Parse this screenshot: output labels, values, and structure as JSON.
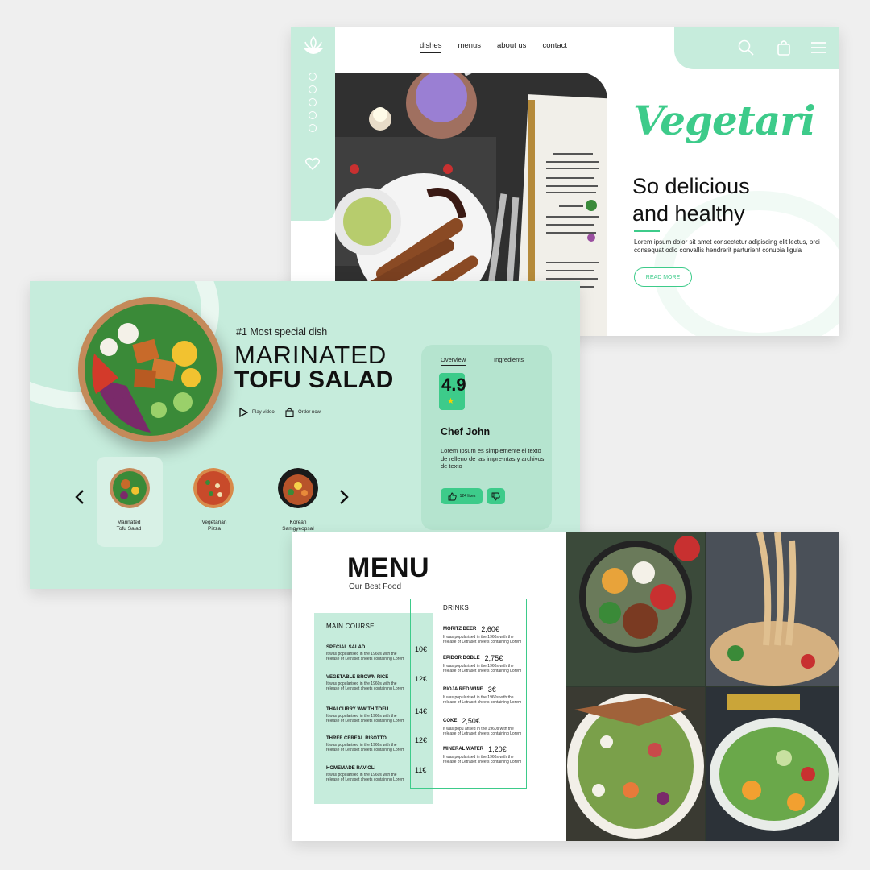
{
  "colors": {
    "accent": "#3dcb8a",
    "mint": "#c6ecdc",
    "mint_dark": "#b5e4cf"
  },
  "hero": {
    "nav": [
      "dishes",
      "menus",
      "about us",
      "contact"
    ],
    "brand": "Vegetari",
    "tagline_1": "So delicious",
    "tagline_2": "and healthy",
    "lorem": "Lorem ipsum dolor sit amet consectetur adipiscing elit lectus, orci consequat odio convallis hendrerit parturient conubia ligula",
    "read_more": "READ MORE",
    "icons": [
      "logo-lotus-icon",
      "heart-icon",
      "search-icon",
      "bag-icon",
      "menu-icon"
    ]
  },
  "dish": {
    "eyebrow": "#1 Most special dish",
    "title_1": "MARINATED",
    "title_2": "TOFU SALAD",
    "play_video": "Play video",
    "order_now": "Order now",
    "carousel": [
      {
        "label_1": "Marinated",
        "label_2": "Tofu Salad"
      },
      {
        "label_1": "Vegetarian",
        "label_2": "Pizza"
      },
      {
        "label_1": "Korean",
        "label_2": "Samgyeopsal"
      }
    ],
    "tabs": {
      "overview": "Overview",
      "ingredients": "Ingredients"
    },
    "rating": "4.9",
    "chef": "Chef John",
    "description": "Lorem Ipsum es simplemente el texto de relleno de las impre-ntas y archivos de texto",
    "likes": "124 likes"
  },
  "menu": {
    "title": "MENU",
    "subtitle": "Our Best Food",
    "main_course_title": "MAIN COURSE",
    "drinks_title": "DRINKS",
    "main_course": [
      {
        "name": "SPECIAL SALAD",
        "price": "10€",
        "desc": "It was popularised in the 1960s with the release of Letraset sheets containing Lorem"
      },
      {
        "name": "VEGETABLE BROWN RICE",
        "price": "12€",
        "desc": "It was popularised in the 1960s with the release of Letraset sheets containing Lorem"
      },
      {
        "name": "THAI CURRY WWITH TOFU",
        "price": "14€",
        "desc": "It was popularised in the 1960s with the release of Letraset sheets containing Lorem"
      },
      {
        "name": "THREE CEREAL RISOTTO",
        "price": "12€",
        "desc": "It was popularised in the 1960s with the release of Letraset sheets containing Lorem"
      },
      {
        "name": "HOMEMADE RAVIOLI",
        "price": "11€",
        "desc": "It was popularised in the 1960s with the release of Letraset sheets containing Lorem"
      }
    ],
    "drinks": [
      {
        "name": "MORITZ BEER",
        "price": "2,60€",
        "desc": "It was popularised in the 1960s with the release of Letraset sheets containing Lorem"
      },
      {
        "name": "EPIDOR DOBLE",
        "price": "2,75€",
        "desc": "It was popularised in the 1960s with the release of Letraset sheets containing Lorem"
      },
      {
        "name": "RIOJA RED WINE",
        "price": "3€",
        "desc": "It was popularised in the 1960s with the release of Letraset sheets containing Lorem"
      },
      {
        "name": "COKE",
        "price": "2,50€",
        "desc": "It was popu arised in the 1960s with the release of Letraset sheets containing Lorem"
      },
      {
        "name": "MINERAL WATER",
        "price": "1,20€",
        "desc": "It was popularised in the 1960s with the release of Letraset sheets containing Lorem"
      }
    ]
  }
}
